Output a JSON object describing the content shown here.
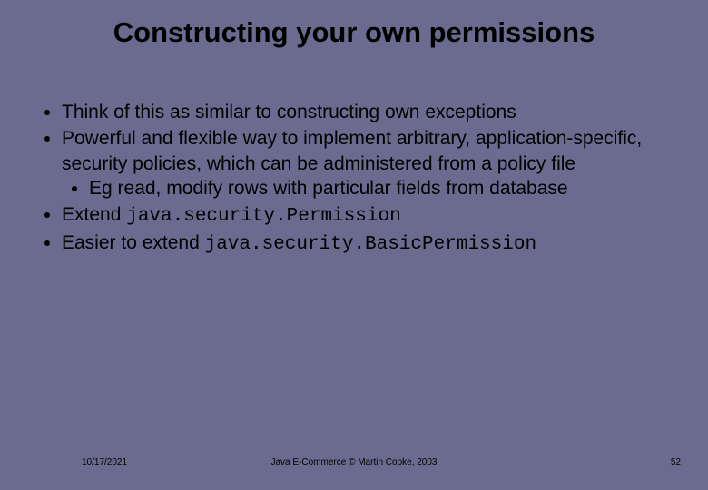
{
  "title": "Constructing your own permissions",
  "bullets": {
    "b1": "Think of this as similar to constructing own exceptions",
    "b2": "Powerful and flexible way to implement arbitrary, application-specific, security policies, which can be administered from a policy file",
    "b2_1": "Eg read, modify rows with particular fields from database",
    "b3_prefix": "Extend ",
    "b3_code": "java.security.Permission",
    "b4_prefix": "Easier to extend ",
    "b4_code": "java.security.BasicPermission"
  },
  "footer": {
    "date": "10/17/2021",
    "center": "Java E-Commerce © Martin Cooke, 2003",
    "page": "52"
  }
}
